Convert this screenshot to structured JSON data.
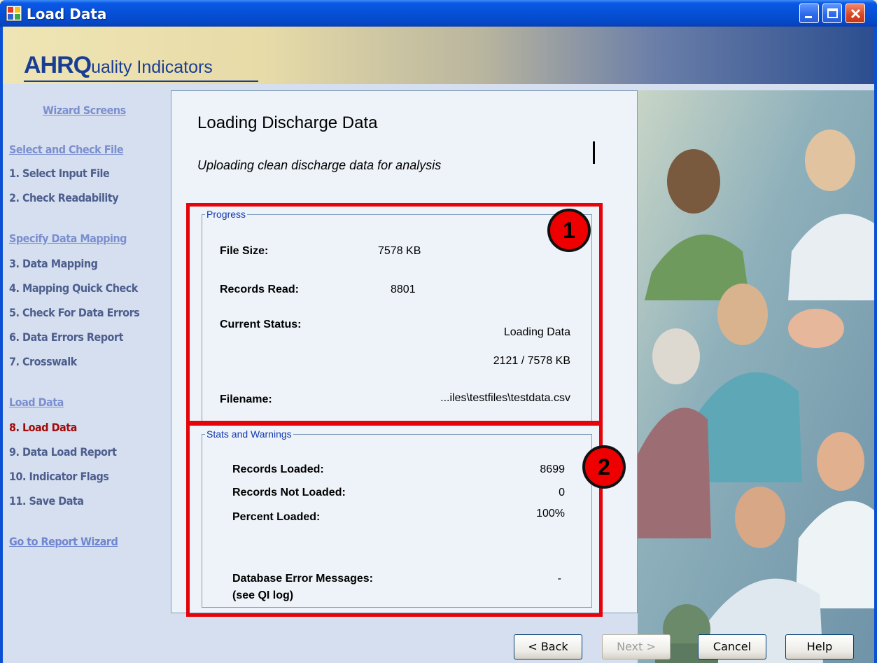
{
  "window": {
    "title": "Load Data"
  },
  "banner": {
    "logo_bold": "AHRQ",
    "logo_rest": "uality Indicators"
  },
  "sidebar": {
    "heading": "Wizard Screens",
    "section1": "Select and Check File",
    "step1": "1. Select Input File",
    "step2": "2. Check Readability",
    "section2": "Specify Data Mapping",
    "step3": "3. Data Mapping",
    "step4": "4. Mapping Quick Check",
    "step5": "5. Check For Data Errors",
    "step6": "6. Data Errors Report",
    "step7": "7. Crosswalk",
    "section3": "Load Data",
    "step8": "8. Load Data",
    "step9": "9. Data Load Report",
    "step10": "10. Indicator Flags",
    "step11": "11. Save Data",
    "report_link": "Go to Report Wizard"
  },
  "main": {
    "title": "Loading Discharge Data",
    "subtitle": "Uploading clean discharge data for analysis"
  },
  "progress": {
    "legend": "Progress",
    "file_size_label": "File Size:",
    "file_size_value": "7578 KB",
    "records_read_label": "Records Read:",
    "records_read_value": "8801",
    "status_label": "Current Status:",
    "status_value": "Loading Data",
    "status_progress": "2121 / 7578 KB",
    "filename_label": "Filename:",
    "filename_value": "...iles\\testfiles\\testdata.csv"
  },
  "stats": {
    "legend": "Stats and Warnings",
    "loaded_label": "Records Loaded:",
    "loaded_value": "8699",
    "not_loaded_label": "Records Not Loaded:",
    "not_loaded_value": "0",
    "percent_label": "Percent Loaded:",
    "percent_value": "100%",
    "db_errors_label": "Database Error Messages:",
    "db_errors_sub": "(see QI log)",
    "db_errors_value": "-"
  },
  "callouts": {
    "one": "1",
    "two": "2"
  },
  "buttons": {
    "back": "< Back",
    "next": "Next >",
    "cancel": "Cancel",
    "help": "Help"
  },
  "colors": {
    "title_bar": "#0650d6",
    "callout_red": "#e6040b",
    "active_step": "#a20b0b",
    "legend_text": "#1238b0"
  }
}
